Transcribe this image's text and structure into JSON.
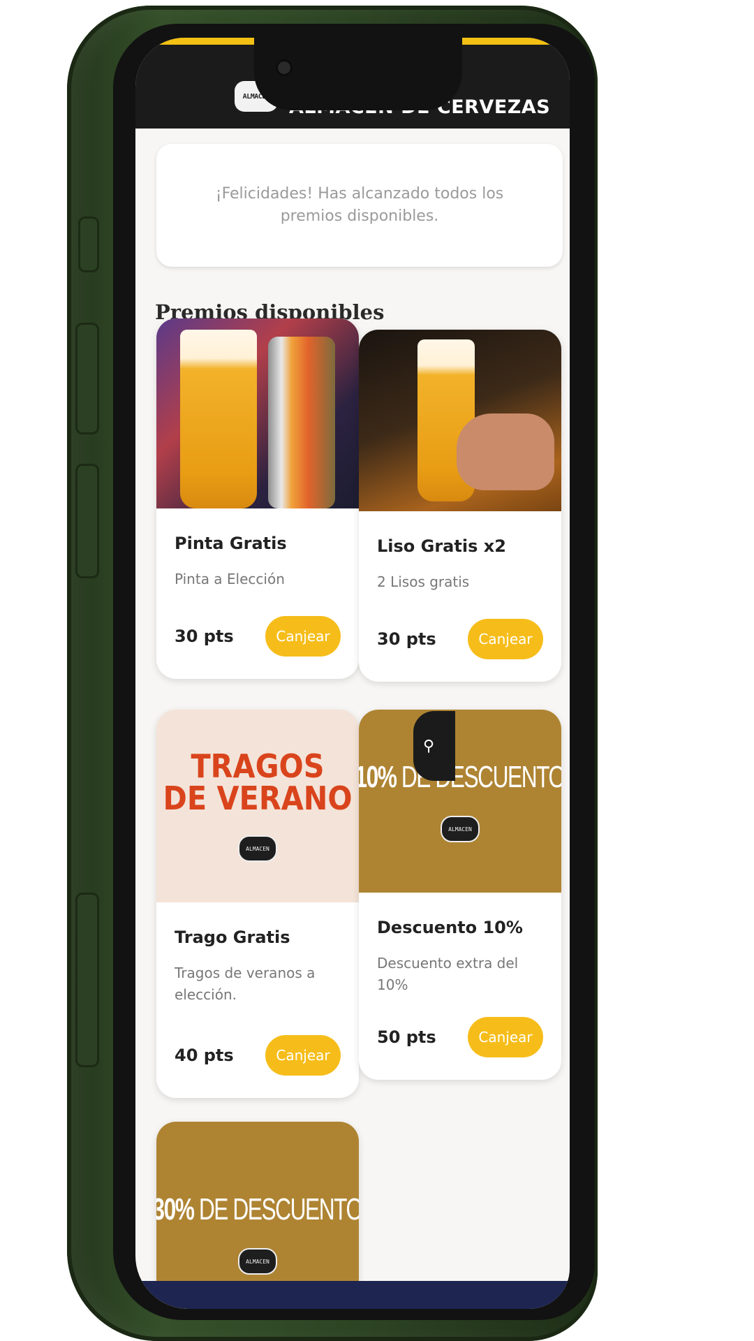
{
  "header": {
    "logo_text": "ALMACEN",
    "title": "ALMACÉN DE CERVEZAS"
  },
  "notice": "¡Felicidades! Has alcanzado todos los premios disponibles.",
  "section_title": "Premios disponibles",
  "rewards": [
    {
      "title": "Pinta Gratis",
      "description": "Pinta a Elección",
      "points": "30 pts",
      "button": "Canjear"
    },
    {
      "title": "Liso Gratis x2",
      "description": "2 Lisos gratis",
      "points": "30 pts",
      "button": "Canjear"
    },
    {
      "title": "Trago Gratis",
      "description": "Tragos de veranos a elección.",
      "points": "40 pts",
      "button": "Canjear",
      "image_text": [
        "TRAGOS",
        "DE VERANO"
      ]
    },
    {
      "title": "Descuento 10%",
      "description": "Descuento extra del 10%",
      "points": "50 pts",
      "button": "Canjear",
      "image_text": [
        "10%",
        " DE DESCUENTO"
      ]
    },
    {
      "image_text": [
        "30%",
        " DE DESCUENTO"
      ]
    }
  ],
  "colors": {
    "accent": "#f6bd1a",
    "header_bg": "#1b1b1b",
    "phone_frame": "#2d4424",
    "summer_text": "#d9441c",
    "gold_bg": "#ae8433"
  },
  "icons": {
    "floating_button": "filter-icon"
  }
}
